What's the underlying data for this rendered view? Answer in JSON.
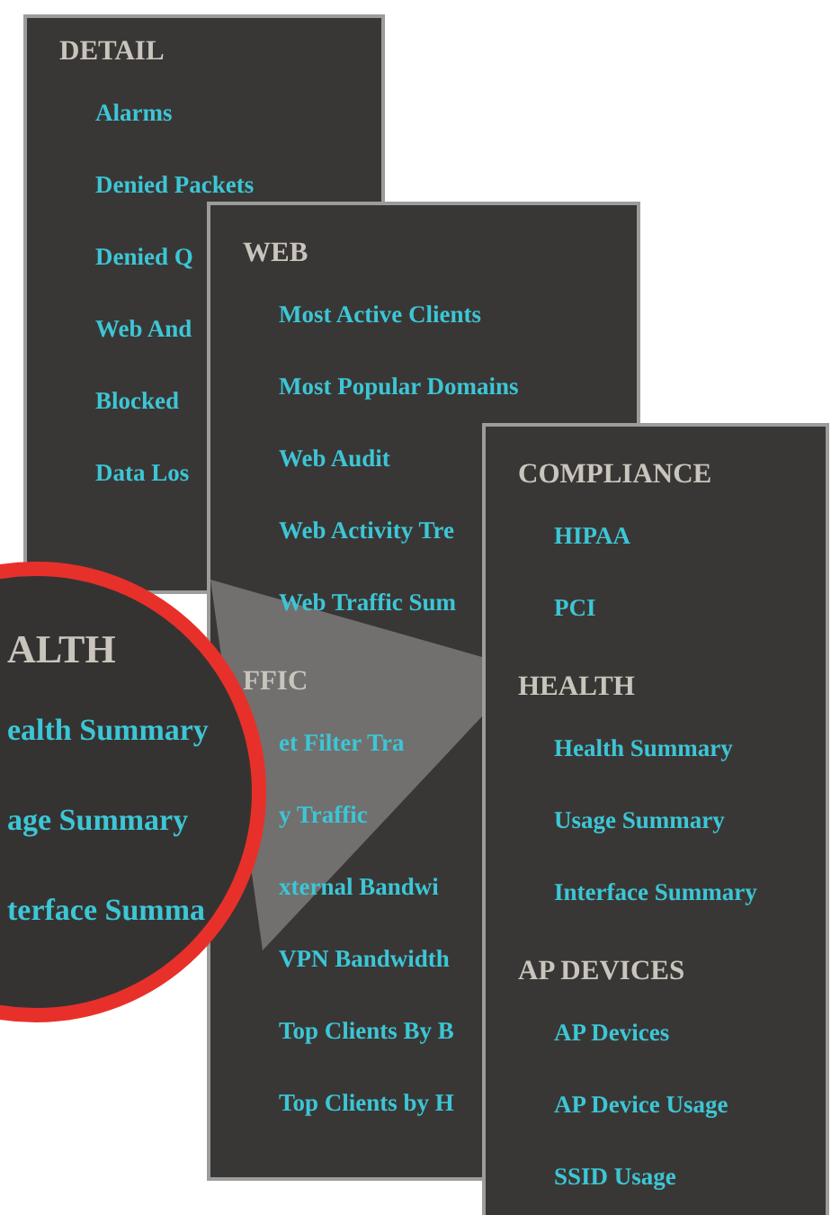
{
  "panels": [
    {
      "sections": [
        {
          "heading": "DETAIL",
          "items": [
            "Alarms",
            "Denied Packets",
            "Denied Q",
            "Web And",
            "Blocked",
            "Data Los"
          ]
        }
      ]
    },
    {
      "sections": [
        {
          "heading": "WEB",
          "items": [
            "Most Active Clients",
            "Most Popular Domains",
            "Web Audit",
            "Web Activity Tre",
            "Web Traffic Sum"
          ]
        },
        {
          "heading": "FFIC",
          "items": [
            "et Filter Tra",
            "y Traffic",
            "xternal Bandwi",
            "VPN Bandwidth",
            "Top Clients By B",
            "Top Clients by H"
          ]
        }
      ]
    },
    {
      "sections": [
        {
          "heading": "COMPLIANCE",
          "items": [
            "HIPAA",
            "PCI"
          ]
        },
        {
          "heading": "HEALTH",
          "items": [
            "Health Summary",
            "Usage Summary",
            "Interface Summary"
          ]
        },
        {
          "heading": "AP DEVICES",
          "items": [
            "AP Devices",
            "AP Device Usage",
            "SSID Usage"
          ]
        }
      ]
    }
  ],
  "magnifier": {
    "heading": "ALTH",
    "items": [
      "ealth Summary",
      "age Summary",
      "terface Summa"
    ]
  }
}
